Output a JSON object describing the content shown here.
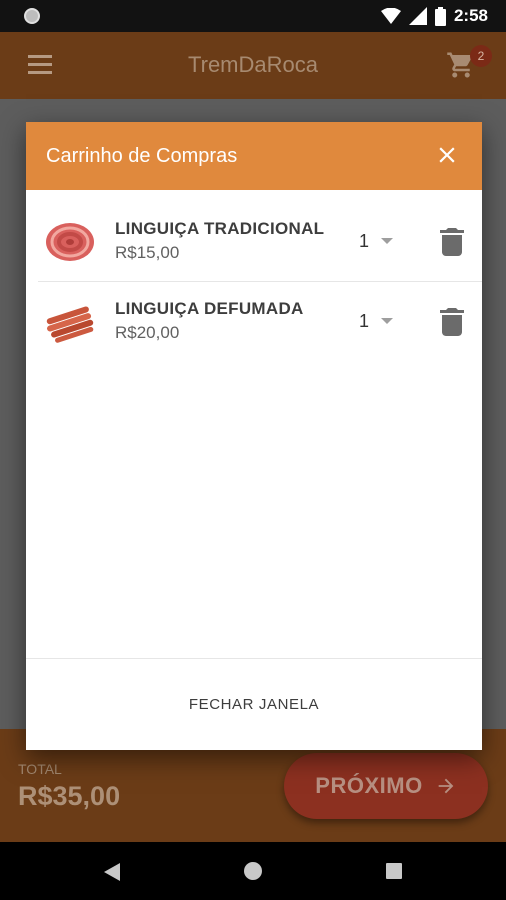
{
  "status_bar": {
    "time": "2:58"
  },
  "app_bar": {
    "title": "TremDaRoca",
    "cart_count": "2"
  },
  "dialog": {
    "title": "Carrinho de Compras",
    "items": [
      {
        "name": "LINGUIÇA TRADICIONAL",
        "price": "R$15,00",
        "quantity": "1"
      },
      {
        "name": "LINGUIÇA DEFUMADA",
        "price": "R$20,00",
        "quantity": "1"
      }
    ],
    "close_label": "FECHAR JANELA"
  },
  "bottom_bar": {
    "total_label": "TOTAL",
    "total_value": "R$35,00",
    "next_label": "PRÓXIMO"
  },
  "icons": {
    "menu": "menu-icon",
    "cart": "cart-icon",
    "close": "close-icon",
    "delete": "trash-icon",
    "dropdown": "chevron-down-icon",
    "next": "arrow-right-icon"
  },
  "colors": {
    "app_bar": "#6b3c17",
    "dialog_header": "#e0893d",
    "next_button": "#8c3020",
    "overlay": "#5d5d5d"
  }
}
